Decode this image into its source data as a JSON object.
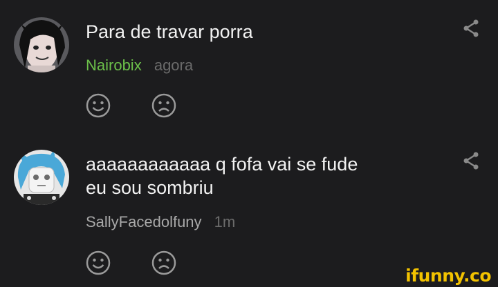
{
  "comments": [
    {
      "text_lines": [
        "Para de travar porra"
      ],
      "username": "Nairobix",
      "time": "agora",
      "username_color": "#6cc04a",
      "avatar_icon": "avatar-dark-hair"
    },
    {
      "text_lines": [
        "aaaaaaaaaaaa q fofa vai se fude",
        "eu sou sombriu"
      ],
      "username": "SallyFacedolfuny",
      "time": "1m",
      "username_color": "#a8a8a8",
      "avatar_icon": "avatar-blue-hair"
    }
  ],
  "icons": {
    "share": "share-icon",
    "smile": "smile-icon",
    "frown": "frown-icon"
  },
  "watermark": "ifunny.co",
  "colors": {
    "background": "#1c1c1e",
    "text": "#f2f2f2",
    "meta_gray": "#6b6b6b",
    "icon_gray": "#9a9a9a",
    "brand_yellow": "#f2c200"
  }
}
